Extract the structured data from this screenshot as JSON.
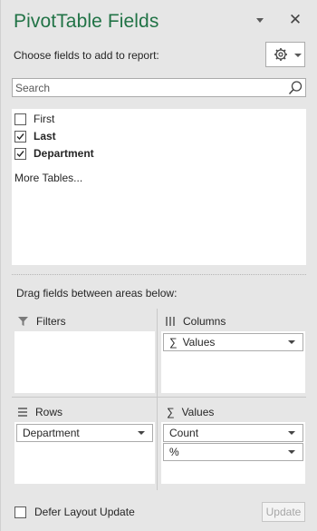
{
  "pane": {
    "title": "PivotTable Fields",
    "choose_label": "Choose fields to add to report:",
    "close_glyph": "✕"
  },
  "search": {
    "placeholder": "Search",
    "value": ""
  },
  "fields": [
    {
      "label": "First",
      "checked": false,
      "bold": false
    },
    {
      "label": "Last",
      "checked": true,
      "bold": true
    },
    {
      "label": "Department",
      "checked": true,
      "bold": true
    }
  ],
  "more_tables": "More Tables...",
  "drag_label": "Drag fields between areas below:",
  "areas": {
    "filters": {
      "label": "Filters",
      "items": []
    },
    "columns": {
      "label": "Columns",
      "items": [
        {
          "label": "Values",
          "sigma": "∑"
        }
      ]
    },
    "rows": {
      "label": "Rows",
      "items": [
        {
          "label": "Department"
        }
      ]
    },
    "values": {
      "label": "Values",
      "items": [
        {
          "label": "Count"
        },
        {
          "label": "%"
        }
      ]
    }
  },
  "footer": {
    "defer_label": "Defer Layout Update",
    "defer_checked": false,
    "update_label": "Update"
  },
  "colors": {
    "title": "#217346",
    "background": "#e6e6e6",
    "disabled_text": "#a6a6a6"
  },
  "icons": [
    "chevron-down-icon",
    "close-icon",
    "gear-icon",
    "search-icon",
    "checkbox-icon",
    "filter-icon",
    "columns-icon",
    "rows-icon",
    "sigma-icon"
  ]
}
